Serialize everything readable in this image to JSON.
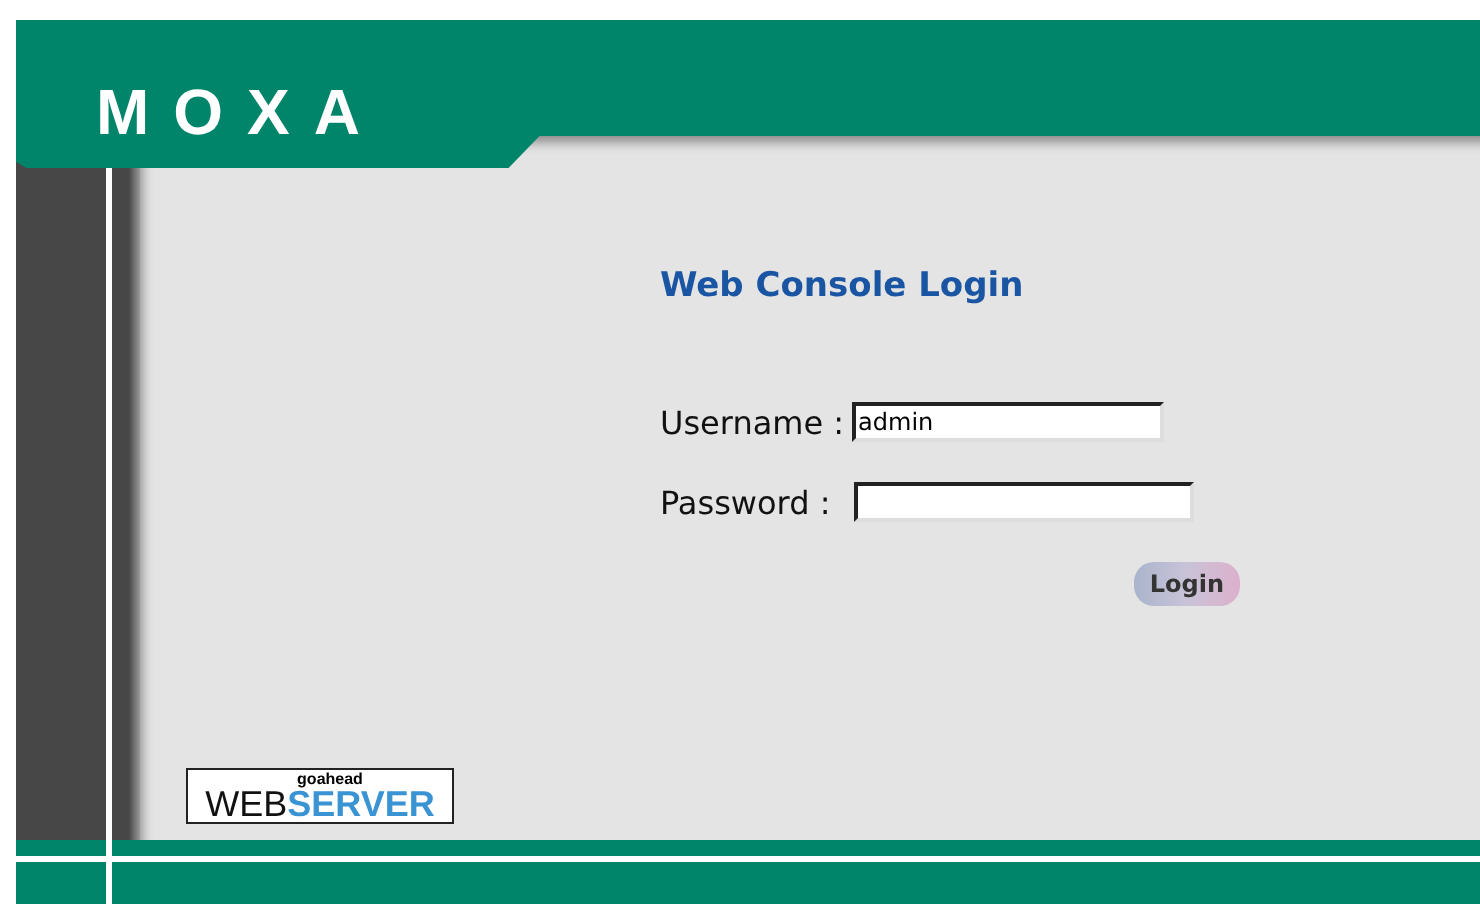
{
  "header": {
    "logo": "MOXA"
  },
  "login": {
    "title": "Web Console Login",
    "fields": [
      {
        "label": "Username :",
        "value": "admin",
        "kind": "text"
      },
      {
        "label": "Password :",
        "kind": "password"
      }
    ],
    "button": "Login"
  },
  "badge": {
    "top": "goahead",
    "left": "WEB",
    "right": "SERVER"
  }
}
